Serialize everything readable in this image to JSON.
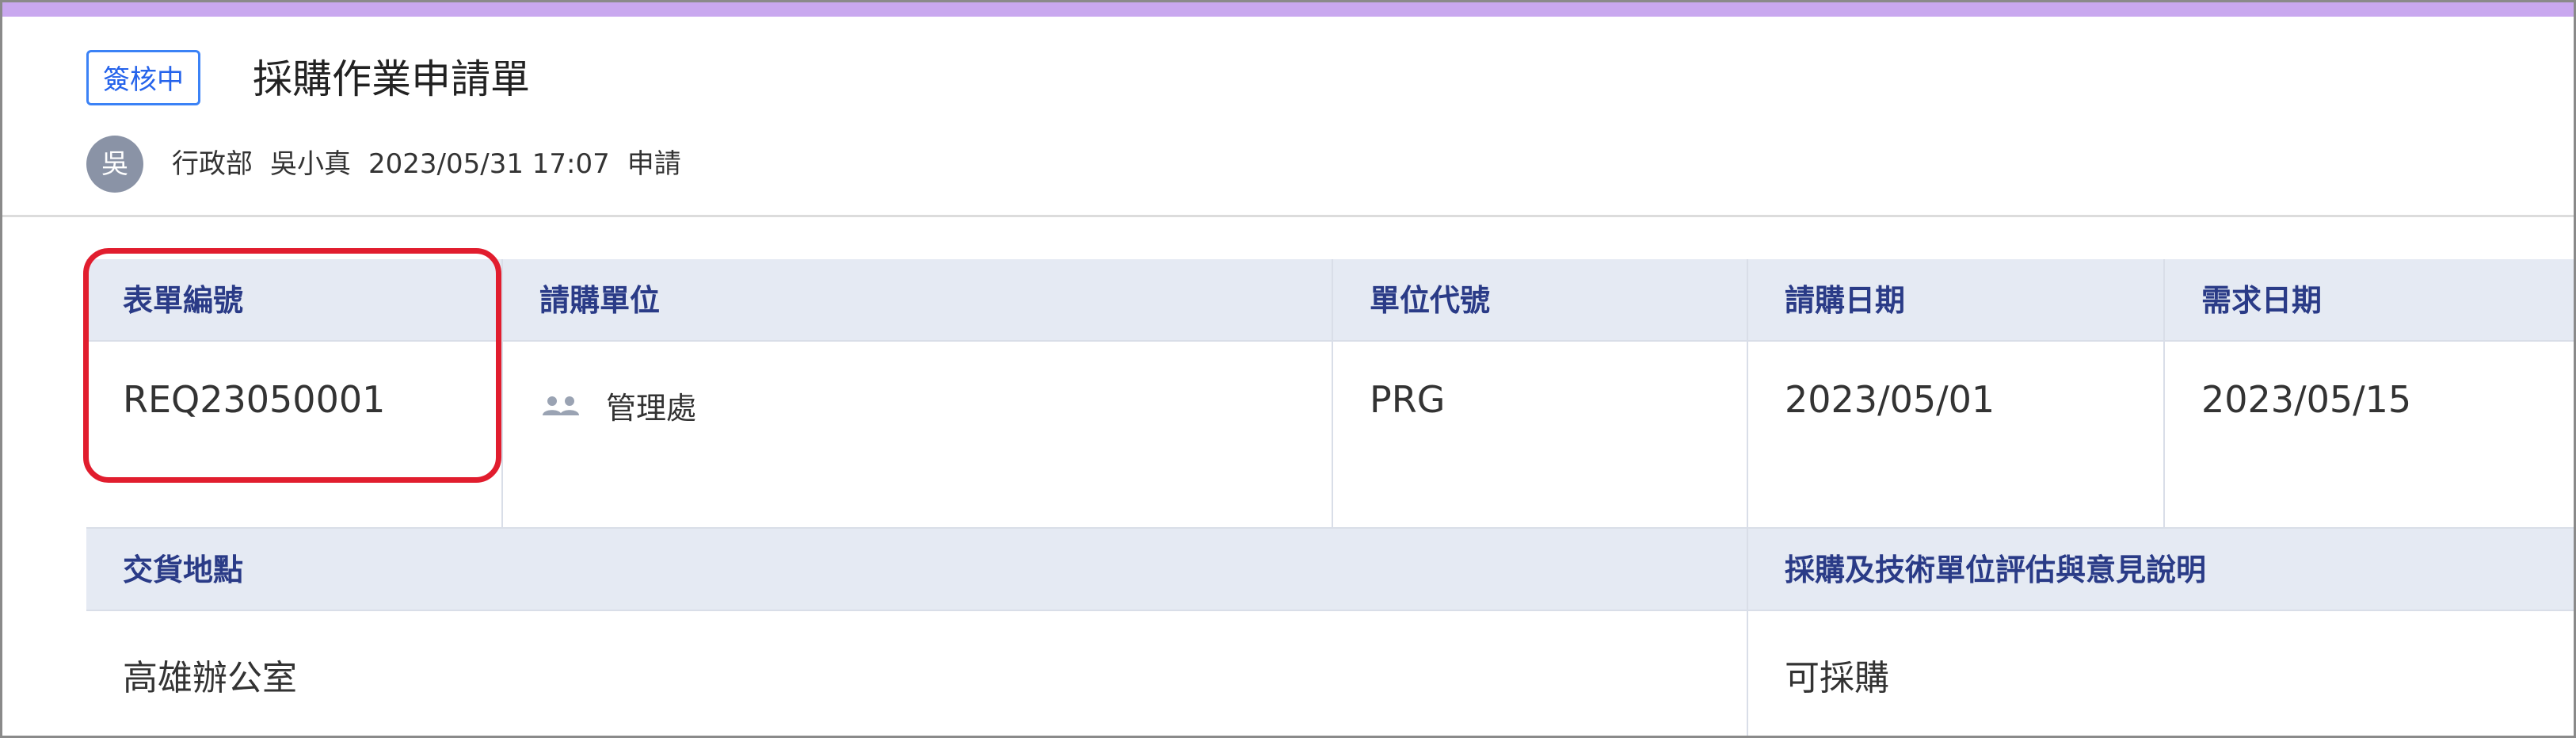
{
  "header": {
    "status": "簽核中",
    "title": "採購作業申請單",
    "avatar_initial": "吳",
    "department": "行政部",
    "applicant": "吳小真",
    "datetime": "2023/05/31 17:07",
    "action": "申請"
  },
  "form": {
    "form_no_label": "表單編號",
    "form_no_value": "REQ23050001",
    "req_unit_label": "請購單位",
    "req_unit_value": "管理處",
    "unit_code_label": "單位代號",
    "unit_code_value": "PRG",
    "req_date_label": "請購日期",
    "req_date_value": "2023/05/01",
    "need_date_label": "需求日期",
    "need_date_value": "2023/05/15",
    "delivery_label": "交貨地點",
    "delivery_value": "高雄辦公室",
    "eval_label": "採購及技術單位評估與意見說明",
    "eval_value": "可採購"
  },
  "colors": {
    "accent_bar": "#c9a8ef",
    "badge": "#2563eb",
    "header_bg": "#e5eaf3",
    "header_text": "#2a3b87",
    "highlight": "#e11d2e"
  },
  "icons": {
    "unit": "users-icon"
  }
}
